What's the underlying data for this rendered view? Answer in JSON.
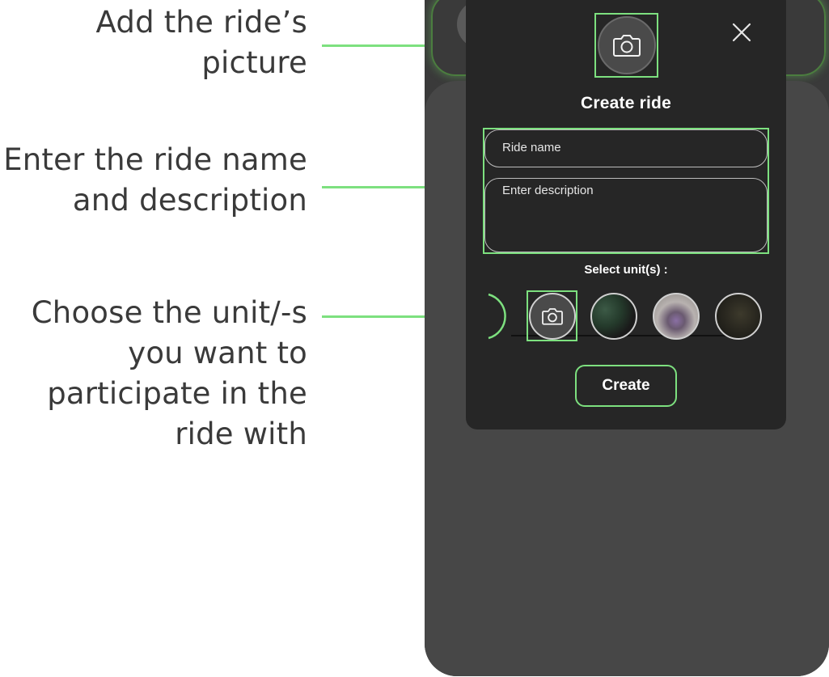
{
  "annotations": {
    "photo": [
      "Add the ride’s",
      "picture"
    ],
    "fields": [
      "Enter the ride name",
      "and description"
    ],
    "units": [
      "Choose the unit/-s",
      "you want to",
      "participate in the",
      "ride with"
    ]
  },
  "modal": {
    "title": "Create ride",
    "name_placeholder": "Ride name",
    "description_placeholder": "Enter description",
    "select_units_label": "Select unit(s) :",
    "create_button": "Create"
  },
  "icons": {
    "close": "close-icon",
    "photo": "camera-icon",
    "add_unit": "camera-icon"
  },
  "colors": {
    "accent": "#7de07f",
    "modal_bg": "#262626",
    "phone_bg": "#3a3a3a",
    "text": "#ffffff",
    "annotation_text": "#3a3a3a"
  }
}
